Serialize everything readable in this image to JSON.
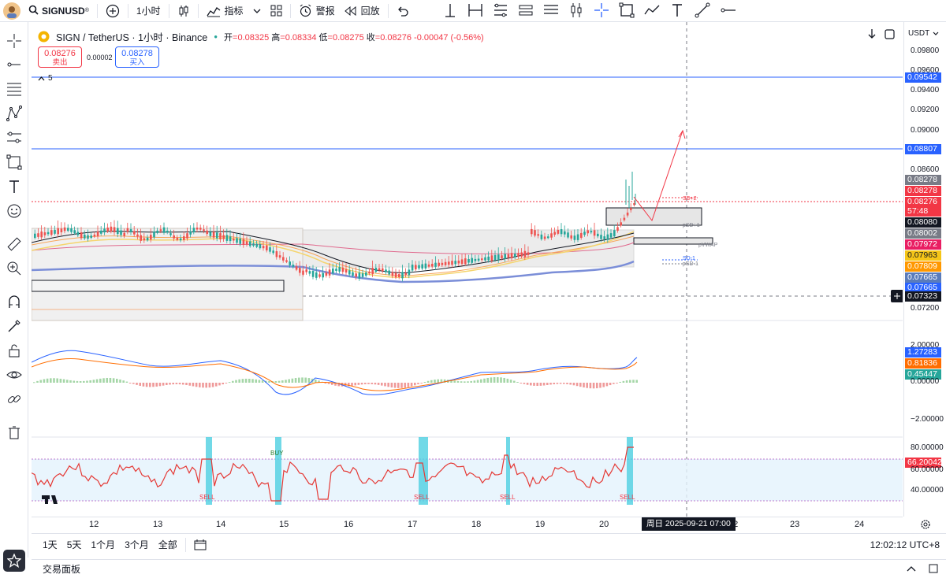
{
  "topbar": {
    "symbol": "SIGNUSD",
    "symbol_sup": "®",
    "add_symbol": "+",
    "interval": "1小时",
    "indicators": "指标",
    "alert": "警报",
    "replay": "回放"
  },
  "legend": {
    "title": "SIGN / TetherUS · 1小时 · Binance",
    "open_label": "开",
    "open": "=0.08325",
    "high_label": "高",
    "high": "=0.08334",
    "low_label": "低",
    "low": "=0.08275",
    "close_label": "收",
    "close": "=0.08276",
    "change": "-0.00047 (-0.56%)"
  },
  "trade": {
    "sell_price": "0.08276",
    "sell_label": "卖出",
    "spread": "0.00002",
    "buy_price": "0.08278",
    "buy_label": "买入"
  },
  "collapse_count": "5",
  "price_axis": {
    "currency": "USDT",
    "ticks": [
      "0.09800",
      "0.09600",
      "0.09400",
      "0.09200",
      "0.09000",
      "0.08600",
      "0.07200"
    ],
    "tags": [
      {
        "label": "0.09542",
        "color": "#2962ff"
      },
      {
        "label": "0.08807",
        "color": "#2962ff"
      },
      {
        "label": "0.08278",
        "color": "#787b86"
      },
      {
        "label": "0.08278",
        "color": "#f23645"
      },
      {
        "label": "0.08276",
        "color": "#f23645"
      },
      {
        "label": "57:48",
        "color": "#f23645"
      },
      {
        "label": "0.08080",
        "color": "#131722"
      },
      {
        "label": "0.08002",
        "color": "#787b86"
      },
      {
        "label": "0.07972",
        "color": "#e91e63"
      },
      {
        "label": "0.07963",
        "color": "#f5c518"
      },
      {
        "label": "0.07809",
        "color": "#ff9800"
      },
      {
        "label": "0.07665",
        "color": "#5b7cbb"
      },
      {
        "label": "0.07665",
        "color": "#2962ff"
      },
      {
        "label": "0.07323",
        "color": "#131722"
      }
    ],
    "macd_ticks": [
      "2.00000",
      "−2.00000"
    ],
    "macd_tags": [
      {
        "label": "1.27283",
        "color": "#2962ff"
      },
      {
        "label": "0.81836",
        "color": "#ff6d00"
      },
      {
        "label": "0.45447",
        "color": "#26a69a"
      },
      {
        "label": "0.00000",
        "color": ""
      }
    ],
    "rsi_ticks": [
      "80.00000",
      "60.00000",
      "40.00000"
    ],
    "rsi_tag": {
      "label": "66.20042",
      "color": "#f23645"
    }
  },
  "annotations": {
    "sd2": "SD+2",
    "psd1": "pSD+1",
    "pvwap": "pVWAP",
    "sd1neg": "SD-1",
    "psd1neg": "pSD-1",
    "buy": "BUY",
    "sell": "SELL"
  },
  "time_axis": {
    "labels": [
      "12",
      "13",
      "14",
      "15",
      "16",
      "17",
      "18",
      "19",
      "20",
      "22",
      "23",
      "24"
    ],
    "crosshair": "周日 2025-09-21    07:00"
  },
  "bottombar": {
    "ranges": [
      "1天",
      "5天",
      "1个月",
      "3个月",
      "全部"
    ],
    "clock": "12:02:12 UTC+8"
  },
  "panel": {
    "title": "交易面板"
  }
}
